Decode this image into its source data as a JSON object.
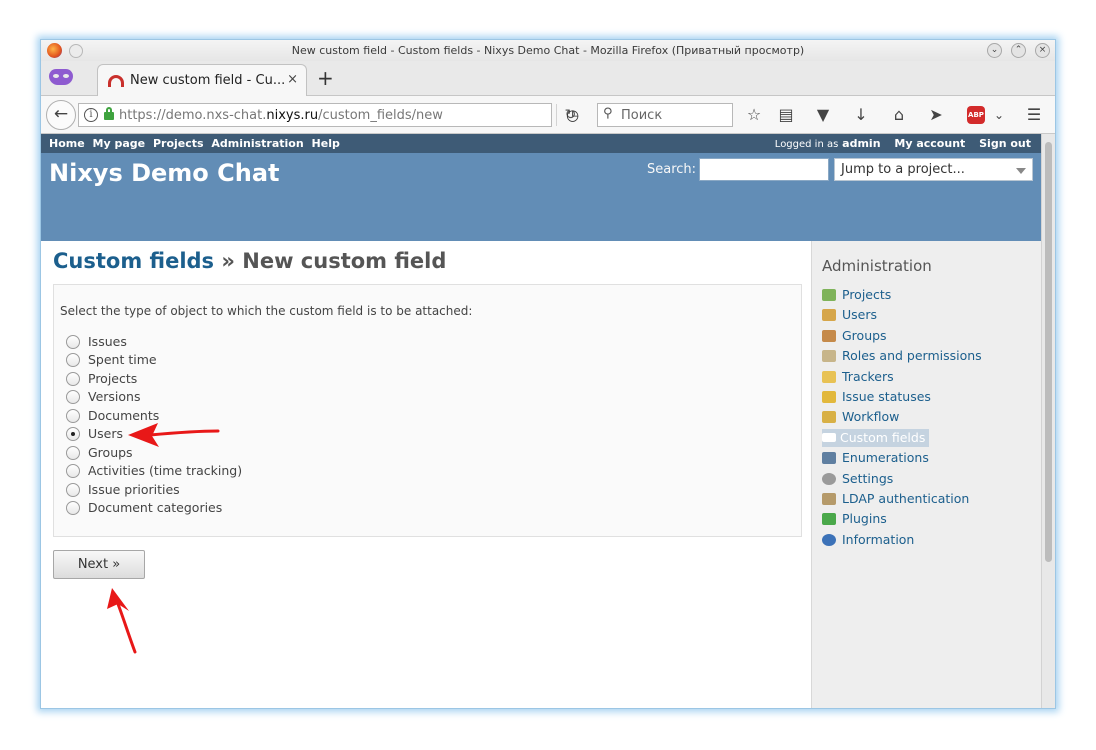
{
  "window": {
    "title": "New custom field - Custom fields - Nixys Demo Chat - Mozilla Firefox (Приватный просмотр)"
  },
  "tab": {
    "label": "New custom field - Cu...",
    "close": "×",
    "new_tab": "+"
  },
  "navbar": {
    "url_prefix": "https://demo.nxs-chat.",
    "url_host": "nixys.ru",
    "url_path": "/custom_fields/new",
    "search_placeholder": "Поиск",
    "abp_label": "ABP"
  },
  "topmenu": {
    "left": [
      "Home",
      "My page",
      "Projects",
      "Administration",
      "Help"
    ],
    "logged_in_prefix": "Logged in as",
    "user": "admin",
    "my_account": "My account",
    "sign_out": "Sign out"
  },
  "header": {
    "site_title": "Nixys Demo Chat",
    "search_label": "Search:",
    "jump_to": "Jump to a project..."
  },
  "main": {
    "breadcrumb": "Custom fields",
    "separator": " » ",
    "title": "New custom field",
    "intro": "Select the type of object to which the custom field is to be attached:",
    "options": [
      {
        "label": "Issues",
        "checked": false
      },
      {
        "label": "Spent time",
        "checked": false
      },
      {
        "label": "Projects",
        "checked": false
      },
      {
        "label": "Versions",
        "checked": false
      },
      {
        "label": "Documents",
        "checked": false
      },
      {
        "label": "Users",
        "checked": true
      },
      {
        "label": "Groups",
        "checked": false
      },
      {
        "label": "Activities (time tracking)",
        "checked": false
      },
      {
        "label": "Issue priorities",
        "checked": false
      },
      {
        "label": "Document categories",
        "checked": false
      }
    ],
    "next_button": "Next »"
  },
  "sidebar": {
    "title": "Administration",
    "items": [
      {
        "label": "Projects",
        "icon": "projects-icon",
        "color": "#7fb35a"
      },
      {
        "label": "Users",
        "icon": "user-icon",
        "color": "#d6a64a"
      },
      {
        "label": "Groups",
        "icon": "group-icon",
        "color": "#c58a4a"
      },
      {
        "label": "Roles and permissions",
        "icon": "roles-icon",
        "color": "#c7b58a"
      },
      {
        "label": "Trackers",
        "icon": "trackers-icon",
        "color": "#e8c254"
      },
      {
        "label": "Issue statuses",
        "icon": "issue-statuses-icon",
        "color": "#e2b83c"
      },
      {
        "label": "Workflow",
        "icon": "workflow-icon",
        "color": "#d8b045"
      },
      {
        "label": "Custom fields",
        "icon": "custom-fields-icon",
        "color": "#ffffff",
        "active": true
      },
      {
        "label": "Enumerations",
        "icon": "enumerations-icon",
        "color": "#5f7fa1"
      },
      {
        "label": "Settings",
        "icon": "settings-icon",
        "color": "#9a9a9a"
      },
      {
        "label": "LDAP authentication",
        "icon": "ldap-icon",
        "color": "#b59a6a"
      },
      {
        "label": "Plugins",
        "icon": "plugins-icon",
        "color": "#4aa84a"
      },
      {
        "label": "Information",
        "icon": "information-icon",
        "color": "#3c72b8"
      }
    ]
  },
  "colors": {
    "topmenu_bg": "#3e5b76",
    "header_bg": "#628db6",
    "link": "#1c5f8d",
    "annotation_arrow": "#e81818"
  }
}
